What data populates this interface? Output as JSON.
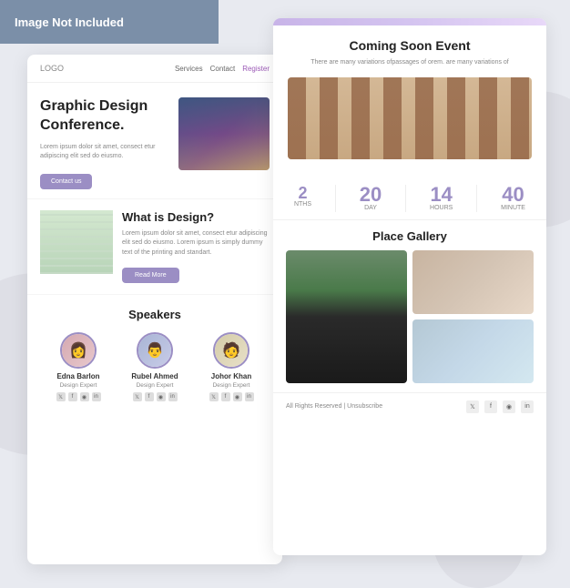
{
  "banner": {
    "text": "Image Not Included"
  },
  "left_card": {
    "nav": {
      "logo": "LOGO",
      "links": [
        "Services",
        "Contact"
      ],
      "register": "Register"
    },
    "hero": {
      "title": "Graphic Design Conference.",
      "description": "Lorem ipsum dolor sit amet, consect etur adipiscing elit sed do eiusmo.",
      "button": "Contact us",
      "image_alt": "conference room"
    },
    "what_section": {
      "title": "What is Design?",
      "description": "Lorem ipsum dolor sit amet, consect etur adipiscing elit sed do eiusmo. Lorem ipsum is simply dummy text of the printing and standart.",
      "button": "Read More",
      "image_alt": "table setting"
    },
    "speakers": {
      "title": "Speakers",
      "items": [
        {
          "name": "Edna Barlon",
          "role": "Design Expert",
          "avatar": "👩"
        },
        {
          "name": "Rubel Ahmed",
          "role": "Design Expert",
          "avatar": "👨"
        },
        {
          "name": "Johor Khan",
          "role": "Design Expert",
          "avatar": "🧑"
        }
      ]
    }
  },
  "right_card": {
    "coming_soon": {
      "title": "Coming Soon Event",
      "description": "There are many variations ofpassages of orem. are many variations of"
    },
    "countdown": {
      "months": {
        "value": "2",
        "label": "NTHS"
      },
      "days": {
        "value": "20",
        "label": "DAY"
      },
      "hours": {
        "value": "14",
        "label": "HOURS"
      },
      "minutes": {
        "value": "40",
        "label": "MINUTE"
      }
    },
    "gallery": {
      "title": "Place Gallery"
    },
    "footer": {
      "left": "All Rights Reserved | Unsubscribe",
      "social": [
        "𝕏",
        "f",
        "◉",
        "in"
      ]
    }
  }
}
